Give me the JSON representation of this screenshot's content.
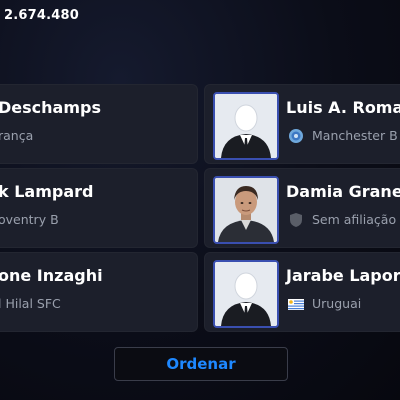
{
  "header": {
    "coins": "2.674.480"
  },
  "left_cards": [
    {
      "name": "Deschamps",
      "club": "rança"
    },
    {
      "name": "k Lampard",
      "club": "oventry B"
    },
    {
      "name": "one Inzaghi",
      "club": "l Hilal SFC"
    }
  ],
  "right_cards": [
    {
      "name": "Luis A. Roman",
      "club": "Manchester B",
      "badge_icon": "manchester-blue-crest-icon",
      "portrait": "silhouette"
    },
    {
      "name": "Damia Granero",
      "club": "Sem afiliação",
      "badge_icon": "shield-icon",
      "portrait": "photo"
    },
    {
      "name": "Jarabe Laporta",
      "club": "Uruguai",
      "badge_icon": "uruguay-flag-icon",
      "portrait": "silhouette"
    }
  ],
  "sort_button": {
    "label": "Ordenar"
  },
  "colors": {
    "accent": "#1e88ff",
    "card_bg": "#1c1f2b",
    "portrait_border": "#3a4fb0"
  }
}
